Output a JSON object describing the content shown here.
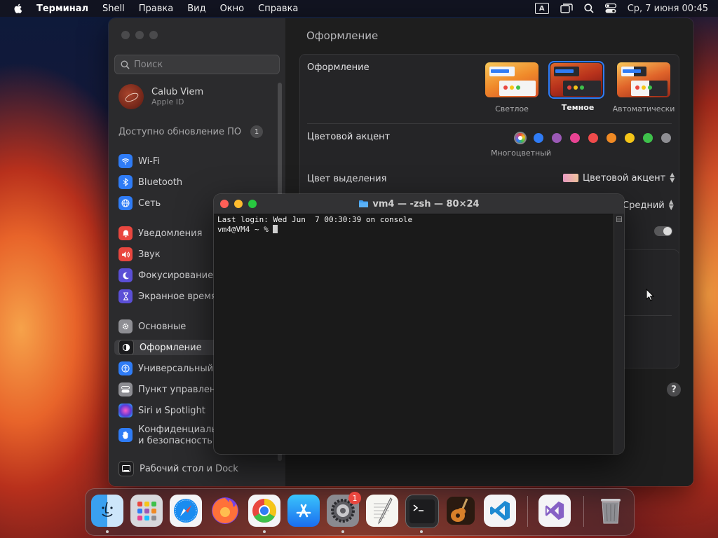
{
  "menubar": {
    "app_name": "Терминал",
    "items": [
      "Shell",
      "Правка",
      "Вид",
      "Окно",
      "Справка"
    ],
    "input_source": "A",
    "clock": "Ср, 7 июня  00:45"
  },
  "settings": {
    "search_placeholder": "Поиск",
    "account": {
      "name": "Calub Viem",
      "subtitle": "Apple ID"
    },
    "update": {
      "label": "Доступно обновление ПО",
      "count": "1"
    },
    "sidebar_items": [
      {
        "label": "Wi-Fi",
        "icon": "wifi-icon",
        "color": "#2f7cf6"
      },
      {
        "label": "Bluetooth",
        "icon": "bluetooth-icon",
        "color": "#2f7cf6"
      },
      {
        "label": "Сеть",
        "icon": "globe-icon",
        "color": "#2f7cf6"
      },
      {
        "label": "Уведомления",
        "icon": "bell-icon",
        "color": "#e9473f"
      },
      {
        "label": "Звук",
        "icon": "speaker-icon",
        "color": "#e9473f"
      },
      {
        "label": "Фокусирование",
        "icon": "moon-icon",
        "color": "#5b4fd6"
      },
      {
        "label": "Экранное время",
        "icon": "hourglass-icon",
        "color": "#5b4fd6"
      },
      {
        "label": "Основные",
        "icon": "gear-icon",
        "color": "#8e8e93"
      },
      {
        "label": "Оформление",
        "icon": "appearance-icon",
        "color": "#1c1c1e"
      },
      {
        "label": "Универсальный доступ",
        "icon": "accessibility-icon",
        "color": "#2f7cf6"
      },
      {
        "label": "Пункт управления",
        "icon": "control-center-icon",
        "color": "#8e8e93"
      },
      {
        "label": "Siri и Spotlight",
        "icon": "siri-icon",
        "color": "#c53fd6"
      },
      {
        "label": "Конфиденциальность и безопасность",
        "icon": "hand-icon",
        "color": "#2f7cf6"
      },
      {
        "label": "Рабочий стол и Dock",
        "icon": "dock-icon",
        "color": "#1c1c1e"
      }
    ],
    "content_title": "Оформление",
    "appearance": {
      "label": "Оформление",
      "options": [
        "Светлое",
        "Темное",
        "Автоматически"
      ],
      "selected": "Темное"
    },
    "accent": {
      "label": "Цветовой акцент",
      "selected_name": "Многоцветный",
      "colors": [
        "#2f7cf6",
        "#9b59b6",
        "#e84393",
        "#ef4b4b",
        "#f08a24",
        "#f5c518",
        "#3ec14b",
        "#8e8e93"
      ]
    },
    "highlight": {
      "label": "Цвет выделения",
      "value": "Цветовой акцент"
    },
    "sidebar_icon_size_value": "Средний",
    "help": "?"
  },
  "terminal": {
    "title": "vm4 — -zsh — 80×24",
    "line1": "Last login: Wed Jun  7 00:30:39 on console",
    "prompt": "vm4@VM4 ~ % "
  },
  "dock": {
    "apps": [
      "Finder",
      "Launchpad",
      "Safari",
      "Firefox",
      "Chrome",
      "App Store",
      "Системные настройки",
      "TextEdit",
      "Терминал",
      "GarageBand",
      "Visual Studio Code",
      "Visual Studio",
      "Корзина"
    ],
    "settings_badge": "1"
  }
}
